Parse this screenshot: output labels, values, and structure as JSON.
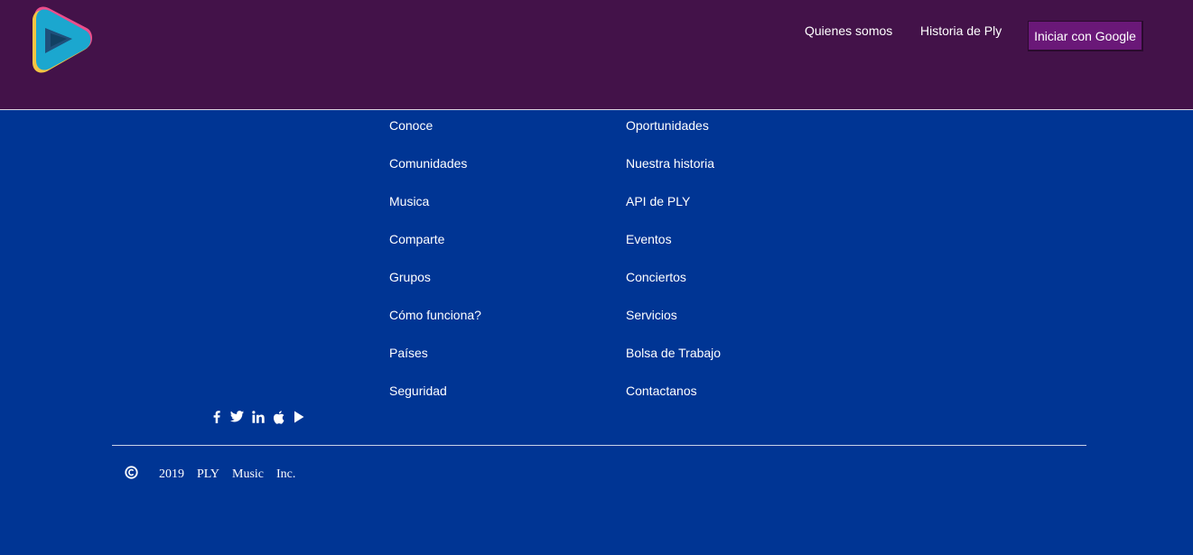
{
  "header": {
    "logo_icon": "ply-play-logo-icon",
    "nav": [
      {
        "label": "Quienes somos"
      },
      {
        "label": "Historia de Ply"
      }
    ],
    "login_button": "Iniciar con Google"
  },
  "footer": {
    "column_a": [
      "Conoce",
      "Comunidades",
      "Musica",
      "Comparte",
      "Grupos",
      "Cómo funciona?",
      "Países",
      "Seguridad"
    ],
    "column_b": [
      "Oportunidades",
      "Nuestra historia",
      "API de PLY",
      "Eventos",
      "Conciertos",
      "Servicios",
      "Bolsa de Trabajo",
      "Contactanos"
    ],
    "social_icons": [
      "facebook-icon",
      "twitter-icon",
      "linkedin-icon",
      "apple-icon",
      "play-store-icon"
    ],
    "copyright": {
      "icon": "copyright-icon",
      "year": "2019",
      "company": "PLY",
      "product": "Music",
      "suffix": "Inc."
    }
  },
  "colors": {
    "header_bg": "#431249",
    "footer_bg": "#003594",
    "button_bg": "#6a1878",
    "text": "#ffffff"
  }
}
